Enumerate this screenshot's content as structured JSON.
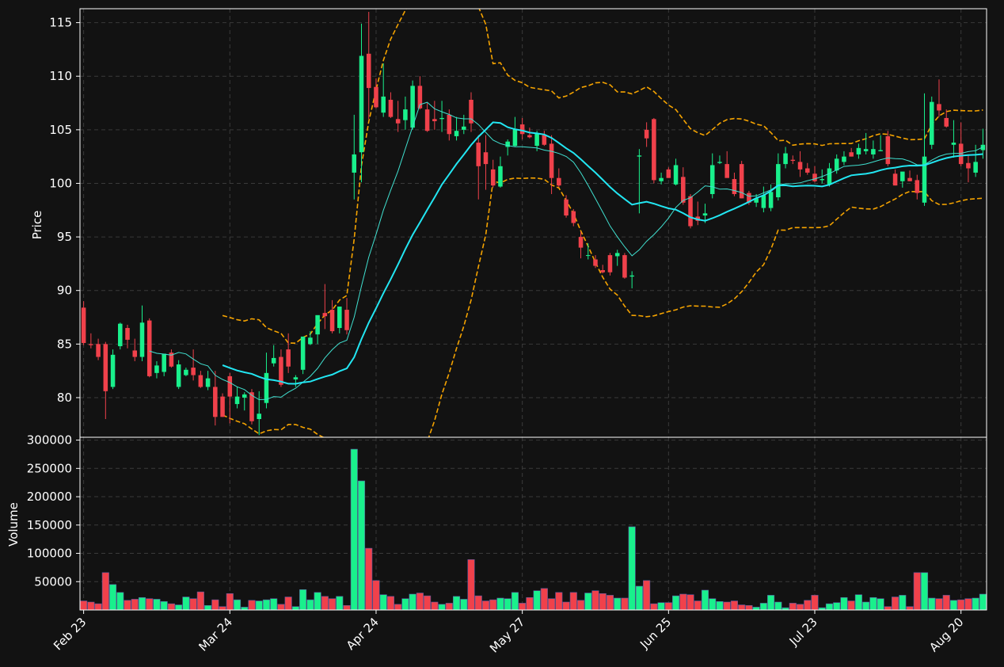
{
  "chart_data": {
    "type": "candlestick",
    "colors": {
      "background": "#121212",
      "up": "#19f08c",
      "down": "#f0414b",
      "ma_fast": "#40e0d0",
      "ma_slow": "#22e6f2",
      "bands": "#f5a300",
      "grid": "#3a3a3a",
      "text": "#ffffff"
    },
    "price_axis": {
      "label": "Price",
      "min": 76.3,
      "max": 116.3,
      "ticks": [
        80,
        85,
        90,
        95,
        100,
        105,
        110,
        115
      ]
    },
    "volume_axis": {
      "label": "Volume",
      "min": 0,
      "max": 305000,
      "ticks": [
        50000,
        100000,
        150000,
        200000,
        250000,
        300000
      ]
    },
    "x_ticks": [
      {
        "label": "Feb 23",
        "index": 0
      },
      {
        "label": "Mar 24",
        "index": 20
      },
      {
        "label": "Apr 24",
        "index": 40
      },
      {
        "label": "May 27",
        "index": 60
      },
      {
        "label": "Jun 25",
        "index": 80
      },
      {
        "label": "Jul 23",
        "index": 100
      },
      {
        "label": "Aug 20",
        "index": 120
      }
    ],
    "candles": [
      [
        88.4,
        89.0,
        84.9,
        85.1,
        16000
      ],
      [
        85.0,
        86.0,
        84.6,
        84.9,
        14000
      ],
      [
        85.0,
        85.5,
        83.5,
        83.8,
        11000
      ],
      [
        85.0,
        85.2,
        78.0,
        80.6,
        66000
      ],
      [
        81.0,
        84.5,
        80.8,
        84.0,
        45000
      ],
      [
        84.8,
        87.0,
        84.5,
        86.9,
        31000
      ],
      [
        86.5,
        86.8,
        84.6,
        85.4,
        17000
      ],
      [
        84.4,
        85.5,
        83.4,
        83.8,
        19000
      ],
      [
        83.8,
        88.6,
        83.4,
        87.0,
        22000
      ],
      [
        87.2,
        87.4,
        81.9,
        82.0,
        20000
      ],
      [
        82.3,
        83.4,
        81.8,
        83.0,
        19000
      ],
      [
        82.4,
        84.0,
        82.0,
        84.1,
        15000
      ],
      [
        84.2,
        84.5,
        82.8,
        82.9,
        11000
      ],
      [
        81.0,
        83.5,
        80.8,
        83.1,
        9000
      ],
      [
        82.1,
        82.8,
        82.0,
        82.6,
        23000
      ],
      [
        82.8,
        84.5,
        81.6,
        82.1,
        20000
      ],
      [
        82.1,
        82.5,
        80.9,
        81.0,
        32000
      ],
      [
        81.0,
        82.5,
        80.7,
        81.8,
        8000
      ],
      [
        81.0,
        82.5,
        77.4,
        78.2,
        18000
      ],
      [
        80.1,
        80.4,
        78.2,
        78.2,
        6000
      ],
      [
        82.0,
        82.3,
        77.6,
        80.1,
        29000
      ],
      [
        79.4,
        81.0,
        79.0,
        80.1,
        18000
      ],
      [
        80.0,
        80.5,
        78.8,
        80.3,
        5000
      ],
      [
        80.5,
        80.8,
        77.5,
        77.8,
        17000
      ],
      [
        78.0,
        80.6,
        76.5,
        78.5,
        16000
      ],
      [
        79.5,
        84.2,
        79.0,
        82.3,
        18000
      ],
      [
        83.2,
        84.9,
        82.9,
        83.7,
        20000
      ],
      [
        83.8,
        84.5,
        81.0,
        81.2,
        10000
      ],
      [
        84.5,
        86.0,
        82.3,
        82.9,
        23000
      ],
      [
        81.7,
        82.1,
        81.0,
        81.9,
        6000
      ],
      [
        82.6,
        85.5,
        82.2,
        85.7,
        36000
      ],
      [
        85.0,
        86.2,
        84.9,
        85.6,
        18000
      ],
      [
        85.9,
        87.0,
        85.0,
        87.7,
        31000
      ],
      [
        87.9,
        90.6,
        86.4,
        87.6,
        24000
      ],
      [
        88.2,
        89.1,
        86.0,
        86.2,
        20000
      ],
      [
        86.5,
        88.5,
        86.0,
        88.5,
        24000
      ],
      [
        88.2,
        89.3,
        85.9,
        86.3,
        8000
      ],
      [
        101.0,
        106.4,
        98.5,
        102.7,
        284000
      ],
      [
        102.9,
        114.9,
        100.1,
        111.9,
        228000
      ],
      [
        112.1,
        116.0,
        106.0,
        108.9,
        109000
      ],
      [
        109.0,
        109.8,
        107.0,
        107.1,
        52000
      ],
      [
        106.6,
        111.2,
        106.2,
        108.1,
        27000
      ],
      [
        107.8,
        108.5,
        106.1,
        106.2,
        24000
      ],
      [
        106.0,
        107.7,
        104.8,
        105.6,
        10000
      ],
      [
        105.9,
        108.1,
        105.0,
        106.9,
        20000
      ],
      [
        105.2,
        109.6,
        105.0,
        109.1,
        28000
      ],
      [
        109.1,
        110.0,
        106.9,
        107.0,
        30000
      ],
      [
        106.9,
        107.5,
        104.8,
        104.9,
        25000
      ],
      [
        106.0,
        107.7,
        105.0,
        105.8,
        14000
      ],
      [
        106.0,
        107.7,
        104.8,
        106.1,
        10000
      ],
      [
        106.4,
        106.9,
        104.0,
        104.6,
        12000
      ],
      [
        104.4,
        106.2,
        104.0,
        104.9,
        24000
      ],
      [
        105.0,
        106.4,
        104.6,
        105.3,
        19000
      ],
      [
        107.8,
        108.5,
        104.8,
        105.6,
        89000
      ],
      [
        103.8,
        104.5,
        98.5,
        101.6,
        25000
      ],
      [
        102.9,
        104.5,
        99.4,
        101.8,
        16000
      ],
      [
        101.3,
        102.2,
        99.6,
        99.8,
        18000
      ],
      [
        99.7,
        102.5,
        99.6,
        101.6,
        21000
      ],
      [
        103.4,
        104.1,
        102.6,
        103.9,
        20000
      ],
      [
        103.5,
        106.2,
        103.4,
        105.1,
        31000
      ],
      [
        105.5,
        106.1,
        104.1,
        104.6,
        12000
      ],
      [
        104.5,
        105.2,
        104.2,
        104.3,
        22000
      ],
      [
        103.5,
        104.9,
        103.0,
        104.7,
        34000
      ],
      [
        104.5,
        104.9,
        103.5,
        103.6,
        38000
      ],
      [
        103.7,
        104.5,
        99.0,
        100.5,
        20000
      ],
      [
        100.5,
        101.4,
        99.6,
        99.8,
        31000
      ],
      [
        98.5,
        98.9,
        96.8,
        97.0,
        14000
      ],
      [
        97.4,
        97.6,
        96.0,
        96.3,
        31000
      ],
      [
        95.0,
        95.5,
        93.0,
        94.0,
        17000
      ],
      [
        93.3,
        94.4,
        92.9,
        93.3,
        30000
      ],
      [
        92.9,
        93.3,
        92.1,
        92.3,
        34000
      ],
      [
        91.9,
        92.4,
        91.6,
        91.7,
        29000
      ],
      [
        93.3,
        93.5,
        91.4,
        91.7,
        26000
      ],
      [
        93.2,
        93.8,
        92.3,
        93.5,
        21000
      ],
      [
        93.3,
        93.5,
        91.1,
        91.2,
        21000
      ],
      [
        91.3,
        91.8,
        90.2,
        91.4,
        147000
      ],
      [
        102.5,
        103.2,
        97.2,
        102.6,
        42000
      ],
      [
        105.0,
        105.7,
        103.4,
        104.2,
        52000
      ],
      [
        106.0,
        106.1,
        100.0,
        100.3,
        11000
      ],
      [
        100.2,
        101.0,
        99.9,
        100.5,
        13000
      ],
      [
        101.3,
        101.5,
        100.5,
        100.5,
        13000
      ],
      [
        99.9,
        102.3,
        99.8,
        101.7,
        25000
      ],
      [
        100.6,
        101.5,
        98.0,
        98.2,
        28000
      ],
      [
        98.8,
        99.0,
        95.8,
        96.0,
        27000
      ],
      [
        96.9,
        98.3,
        96.1,
        96.5,
        16000
      ],
      [
        97.0,
        98.1,
        96.3,
        97.2,
        35000
      ],
      [
        99.0,
        102.8,
        98.6,
        101.7,
        20000
      ],
      [
        101.9,
        102.6,
        101.8,
        102.0,
        15000
      ],
      [
        101.8,
        103.0,
        100.8,
        100.5,
        14000
      ],
      [
        100.4,
        101.0,
        98.8,
        99.0,
        16000
      ],
      [
        101.8,
        102.1,
        98.6,
        98.6,
        9000
      ],
      [
        99.1,
        99.3,
        98.0,
        98.2,
        8000
      ],
      [
        98.2,
        99.0,
        97.8,
        98.6,
        5000
      ],
      [
        97.7,
        99.7,
        97.3,
        98.9,
        12000
      ],
      [
        97.7,
        99.9,
        97.4,
        99.2,
        26000
      ],
      [
        98.7,
        102.8,
        98.4,
        101.8,
        14000
      ],
      [
        101.8,
        103.4,
        101.4,
        102.8,
        4000
      ],
      [
        102.2,
        102.6,
        101.8,
        102.1,
        12000
      ],
      [
        102.0,
        103.0,
        100.6,
        101.3,
        10000
      ],
      [
        101.4,
        101.9,
        100.8,
        101.0,
        17000
      ],
      [
        100.9,
        101.6,
        100.1,
        100.2,
        26000
      ],
      [
        100.3,
        101.3,
        100.0,
        100.4,
        4000
      ],
      [
        99.9,
        101.9,
        99.7,
        101.4,
        11000
      ],
      [
        101.2,
        102.7,
        100.9,
        102.3,
        13000
      ],
      [
        102.0,
        103.0,
        101.7,
        102.5,
        22000
      ],
      [
        102.9,
        103.3,
        102.5,
        102.5,
        16000
      ],
      [
        102.7,
        103.7,
        102.3,
        103.3,
        27000
      ],
      [
        103.0,
        104.7,
        102.7,
        103.2,
        14000
      ],
      [
        102.7,
        104.0,
        102.3,
        103.2,
        22000
      ],
      [
        103.0,
        104.5,
        103.0,
        103.1,
        20000
      ],
      [
        104.4,
        104.9,
        101.6,
        101.8,
        6000
      ],
      [
        100.9,
        101.3,
        99.8,
        99.8,
        23000
      ],
      [
        100.2,
        101.0,
        99.6,
        101.1,
        26000
      ],
      [
        100.5,
        101.2,
        100.2,
        100.2,
        6000
      ],
      [
        100.3,
        100.8,
        98.5,
        99.1,
        66000
      ],
      [
        98.2,
        108.4,
        97.9,
        102.5,
        66000
      ],
      [
        103.6,
        108.1,
        103.2,
        107.6,
        21000
      ],
      [
        107.4,
        109.7,
        106.2,
        106.8,
        20000
      ],
      [
        106.1,
        106.9,
        105.2,
        105.3,
        26000
      ],
      [
        103.6,
        105.9,
        102.4,
        103.8,
        17000
      ],
      [
        103.7,
        105.7,
        101.6,
        101.8,
        18000
      ],
      [
        101.9,
        102.7,
        100.1,
        101.4,
        20000
      ],
      [
        101.0,
        103.6,
        100.6,
        102.0,
        21000
      ],
      [
        103.1,
        105.1,
        102.3,
        103.6,
        28000
      ]
    ]
  }
}
